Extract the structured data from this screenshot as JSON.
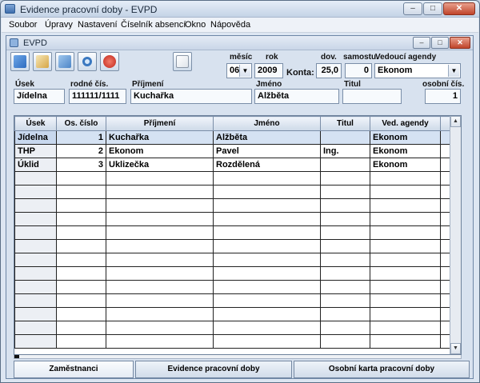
{
  "window": {
    "title": "Evidence pracovní doby - EVPD",
    "min": "–",
    "max": "□",
    "close": "✕"
  },
  "menu": [
    "Soubor",
    "Úpravy",
    "Nastavení",
    "Číselník absencí",
    "Okno",
    "Nápověda"
  ],
  "child": {
    "title": "EVPD",
    "min": "–",
    "max": "□",
    "close": "✕"
  },
  "toolbar": {
    "icons": [
      "new-record-icon",
      "edit-icon",
      "table-icon",
      "search-icon",
      "power-off-icon",
      "delete-icon"
    ]
  },
  "period": {
    "month_label": "měsíc",
    "month_value": "06",
    "year_label": "rok",
    "year_value": "2009",
    "konta_label": "Konta:",
    "dov_label": "dov.",
    "dov_value": "25,0",
    "samost_label": "samostu.",
    "samost_value": "0",
    "agenda_label": "Vedoucí agendy",
    "agenda_value": "Ekonom"
  },
  "employee": {
    "usek_label": "Úsek",
    "usek_value": "Jídelna",
    "rc_label": "rodné čís.",
    "rc_value": "111111/1111",
    "prijmeni_label": "Příjmení",
    "prijmeni_value": "Kuchařka",
    "jmeno_label": "Jméno",
    "jmeno_value": "Alžběta",
    "titul_label": "Titul",
    "titul_value": "",
    "osobni_label": "osobní čís.",
    "osobni_value": "1"
  },
  "table": {
    "columns": [
      "Úsek",
      "Os. číslo",
      "Příjmení",
      "Jméno",
      "Titul",
      "Ved. agendy"
    ],
    "rows": [
      [
        "Jídelna",
        "1",
        "Kuchařka",
        "Alžběta",
        "",
        "Ekonom"
      ],
      [
        "THP",
        "2",
        "Ekonom",
        "Pavel",
        "Ing.",
        "Ekonom"
      ],
      [
        "Úklid",
        "3",
        "Uklizečka",
        "Rozdělená",
        "",
        "Ekonom"
      ],
      [
        "",
        "",
        "",
        "",
        "",
        ""
      ],
      [
        "",
        "",
        "",
        "",
        "",
        ""
      ],
      [
        "",
        "",
        "",
        "",
        "",
        ""
      ],
      [
        "",
        "",
        "",
        "",
        "",
        ""
      ],
      [
        "",
        "",
        "",
        "",
        "",
        ""
      ],
      [
        "",
        "",
        "",
        "",
        "",
        ""
      ],
      [
        "",
        "",
        "",
        "",
        "",
        ""
      ],
      [
        "",
        "",
        "",
        "",
        "",
        ""
      ],
      [
        "",
        "",
        "",
        "",
        "",
        ""
      ],
      [
        "",
        "",
        "",
        "",
        "",
        ""
      ],
      [
        "",
        "",
        "",
        "",
        "",
        ""
      ],
      [
        "",
        "",
        "",
        "",
        "",
        ""
      ],
      [
        "",
        "",
        "",
        "",
        "",
        ""
      ]
    ]
  },
  "tabs": [
    "Zaměstnanci",
    "Evidence pracovní doby",
    "Osobní karta pracovní doby"
  ]
}
